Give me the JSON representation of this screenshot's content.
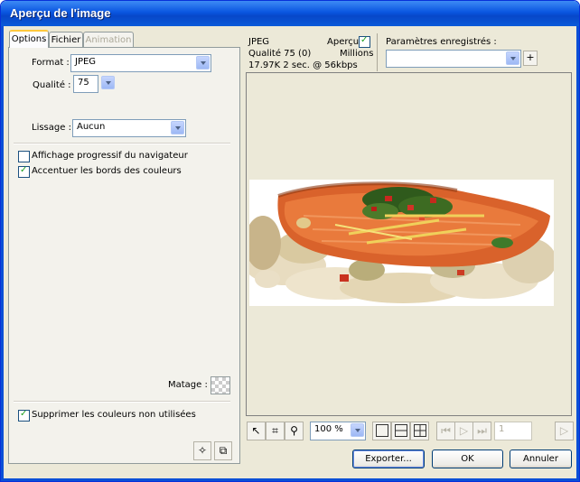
{
  "window": {
    "title": "Aperçu de l'image"
  },
  "tabs": [
    {
      "label": "Options",
      "state": "active"
    },
    {
      "label": "Fichier",
      "state": "normal"
    },
    {
      "label": "Animation",
      "state": "disabled"
    }
  ],
  "options": {
    "format_label": "Format :",
    "format_value": "JPEG",
    "quality_label": "Qualité :",
    "quality_value": "75",
    "smoothing_label": "Lissage :",
    "smoothing_value": "Aucun",
    "progressive_label": "Affichage progressif du navigateur",
    "progressive_checked": false,
    "sharpen_label": "Accentuer les bords des couleurs",
    "sharpen_checked": true,
    "matte_label": "Matage :",
    "remove_unused_label": "Supprimer les couleurs non utilisées",
    "remove_unused_checked": true
  },
  "preview_info": {
    "format": "JPEG",
    "quality": "Qualité 75 (0)",
    "size_time": "17.97K  2 sec. @ 56kbps",
    "preview_label": "Aperçu",
    "preview_checked": true,
    "colors": "Millions"
  },
  "saved_settings": {
    "label": "Paramètres enregistrés :",
    "value": "",
    "add_glyph": "+"
  },
  "toolbar": {
    "zoom_value": "100 %",
    "frame_value": "1"
  },
  "buttons": {
    "export": "Exporter...",
    "ok": "OK",
    "cancel": "Annuler"
  },
  "colors": {
    "titlebar": "#0a55e0",
    "dialog_bg": "#ece9d8",
    "check": "#21a121"
  }
}
